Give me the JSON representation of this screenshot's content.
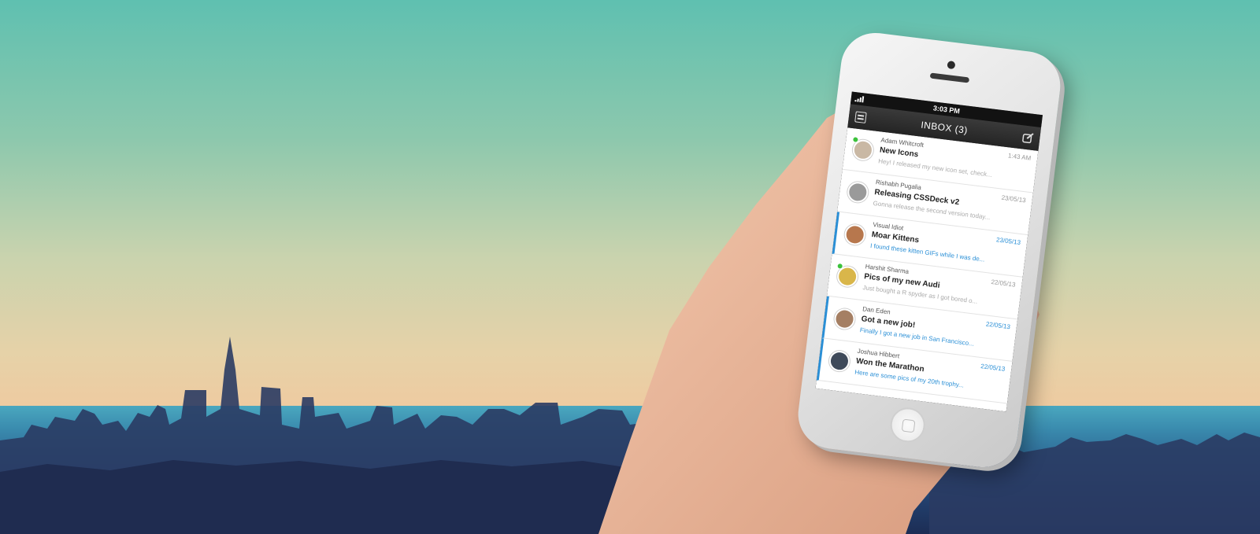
{
  "status_bar": {
    "time": "3:03 PM"
  },
  "nav": {
    "title": "INBOX (3)",
    "menu_icon": "menu-icon",
    "compose_icon": "compose-icon"
  },
  "messages": [
    {
      "sender": "Adam Whitcroft",
      "time": "1:43 AM",
      "subject": "New Icons",
      "preview": "Hey! I released my new icon set, check...",
      "unread": false,
      "online": true,
      "avatar_color": "#c9b8a4"
    },
    {
      "sender": "Rishabh Pugalia",
      "time": "23/05/13",
      "subject": "Releasing CSSDeck v2",
      "preview": "Gonna release the second version today...",
      "unread": false,
      "online": false,
      "avatar_color": "#9a9a9a"
    },
    {
      "sender": "Visual Idiot",
      "time": "23/05/13",
      "subject": "Moar Kittens",
      "preview": "I found these kitten GIFs while I was de...",
      "unread": true,
      "online": false,
      "avatar_color": "#b7774d"
    },
    {
      "sender": "Harshit Sharma",
      "time": "22/05/13",
      "subject": "Pics of my new Audi",
      "preview": "Just bought a R spyder as I got bored o...",
      "unread": false,
      "online": true,
      "avatar_color": "#d9b64a"
    },
    {
      "sender": "Dan Eden",
      "time": "22/05/13",
      "subject": "Got a new job!",
      "preview": "Finally I got a new job in San Francisco...",
      "unread": true,
      "online": false,
      "avatar_color": "#a57f63"
    },
    {
      "sender": "Joshua Hibbert",
      "time": "22/05/13",
      "subject": "Won the Marathon",
      "preview": "Here are some pics of my 20th trophy...",
      "unread": true,
      "online": false,
      "avatar_color": "#3f4a5a"
    }
  ]
}
